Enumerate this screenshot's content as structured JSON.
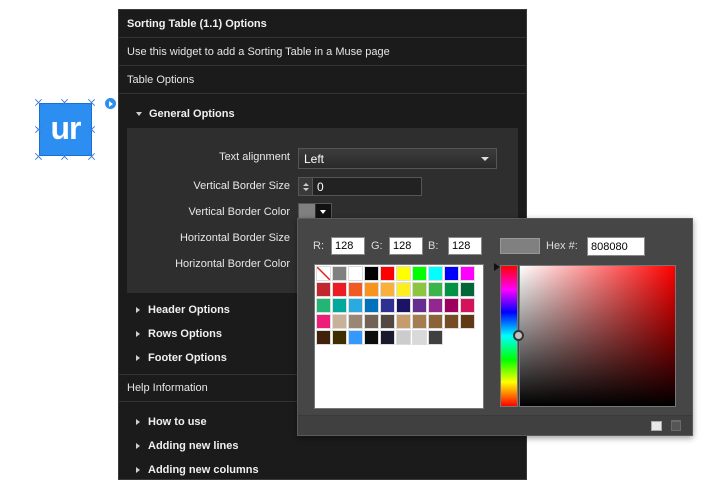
{
  "widget": {
    "icon_text": "ur"
  },
  "panel": {
    "title": "Sorting Table (1.1) Options",
    "description": "Use this widget to add a Sorting Table in a Muse page",
    "table_options": "Table Options",
    "general_options": "General Options",
    "fields": {
      "text_alignment_label": "Text alignment",
      "text_alignment_value": "Left",
      "vertical_border_size_label": "Vertical Border Size",
      "vertical_border_size_value": "0",
      "vertical_border_color_label": "Vertical Border Color",
      "horizontal_border_size_label": "Horizontal Border Size",
      "horizontal_border_color_label": "Horizontal Border Color"
    },
    "sections": [
      "Header Options",
      "Rows Options",
      "Footer Options"
    ],
    "help_information": "Help Information",
    "help_sections": [
      "How to use",
      "Adding new lines",
      "Adding new columns"
    ]
  },
  "color_picker": {
    "r_label": "R:",
    "r_value": "128",
    "g_label": "G:",
    "g_value": "128",
    "b_label": "B:",
    "b_value": "128",
    "hex_label": "Hex #:",
    "hex_value": "808080",
    "current_color": "#808080",
    "swatches": [
      [
        "none",
        "#808080",
        "#ffffff",
        "#000000",
        "#ff0000",
        "#ffff00",
        "#00ff00",
        "#00ffff",
        "#0000ff",
        "#ff00ff"
      ],
      [
        "#c1272d",
        "#ed1c24",
        "#f15a24",
        "#f7931e",
        "#fbb03b",
        "#fcee21",
        "#8cc63f",
        "#39b54a",
        "#009245",
        "#006837"
      ],
      [
        "#22b573",
        "#00a99d",
        "#29abe2",
        "#0071bc",
        "#2e3192",
        "#1b1464",
        "#662d91",
        "#93278f",
        "#9e005d",
        "#d4145a"
      ],
      [
        "#ed1e79",
        "#c7b299",
        "#998675",
        "#736357",
        "#534741",
        "#c69c6d",
        "#a67c52",
        "#8c6239",
        "#754c24",
        "#603813"
      ],
      [
        "#42210b",
        "#3f2e00",
        "#3399ff",
        "#0c0c0c",
        "#1a1a2e",
        "#cccccc",
        "#d9d9d9",
        "#404040"
      ]
    ]
  }
}
